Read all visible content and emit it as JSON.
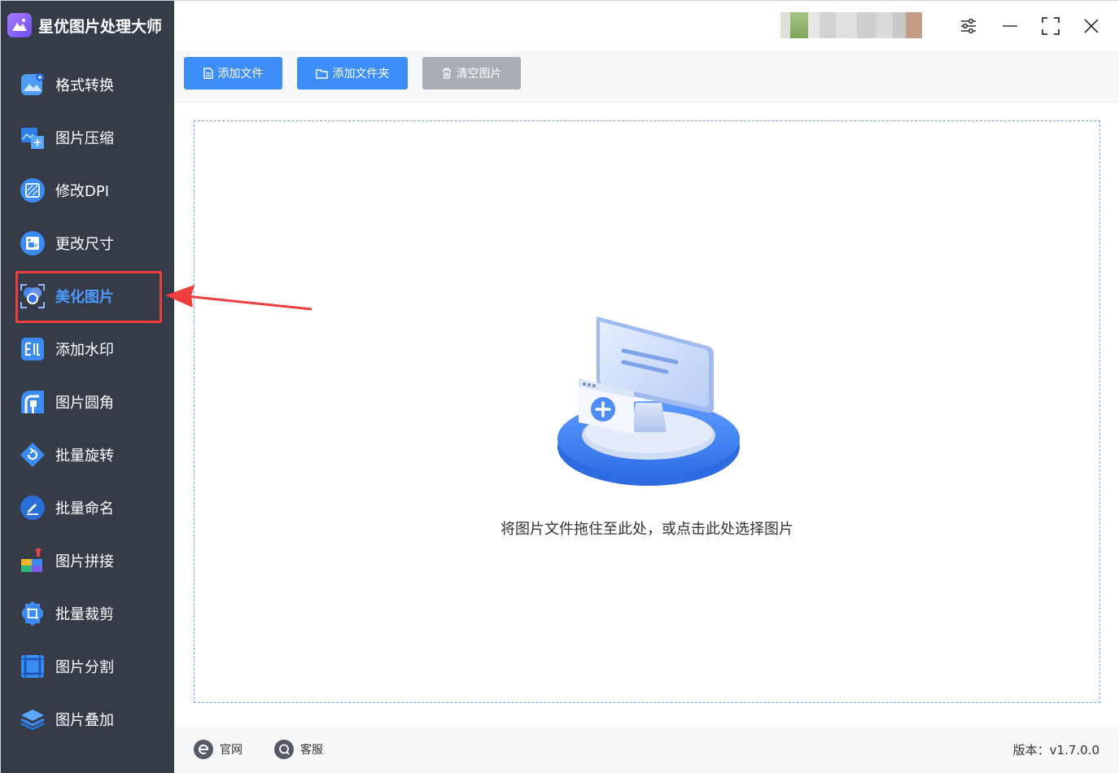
{
  "app": {
    "title": "星优图片处理大师"
  },
  "sidebar": {
    "items": [
      {
        "label": "格式转换",
        "icon": "image-convert-icon"
      },
      {
        "label": "图片压缩",
        "icon": "image-compress-icon"
      },
      {
        "label": "修改DPI",
        "icon": "dpi-icon"
      },
      {
        "label": "更改尺寸",
        "icon": "resize-icon"
      },
      {
        "label": "美化图片",
        "icon": "beautify-icon",
        "active": true
      },
      {
        "label": "添加水印",
        "icon": "watermark-icon"
      },
      {
        "label": "图片圆角",
        "icon": "round-corner-icon"
      },
      {
        "label": "批量旋转",
        "icon": "rotate-icon"
      },
      {
        "label": "批量命名",
        "icon": "rename-icon"
      },
      {
        "label": "图片拼接",
        "icon": "puzzle-icon"
      },
      {
        "label": "批量裁剪",
        "icon": "crop-icon"
      },
      {
        "label": "图片分割",
        "icon": "split-icon"
      },
      {
        "label": "图片叠加",
        "icon": "layers-icon"
      }
    ]
  },
  "toolbar": {
    "add_file": "添加文件",
    "add_folder": "添加文件夹",
    "clear": "清空图片"
  },
  "dropzone": {
    "hint": "将图片文件拖住至此处，或点击此处选择图片"
  },
  "footer": {
    "website": "官网",
    "support": "客服",
    "version": "版本：v1.7.0.0"
  },
  "colors": {
    "sidebar_bg": "#363b48",
    "accent": "#3d8ef8",
    "active_text": "#4e9bff",
    "highlight": "#ee3e3e"
  }
}
